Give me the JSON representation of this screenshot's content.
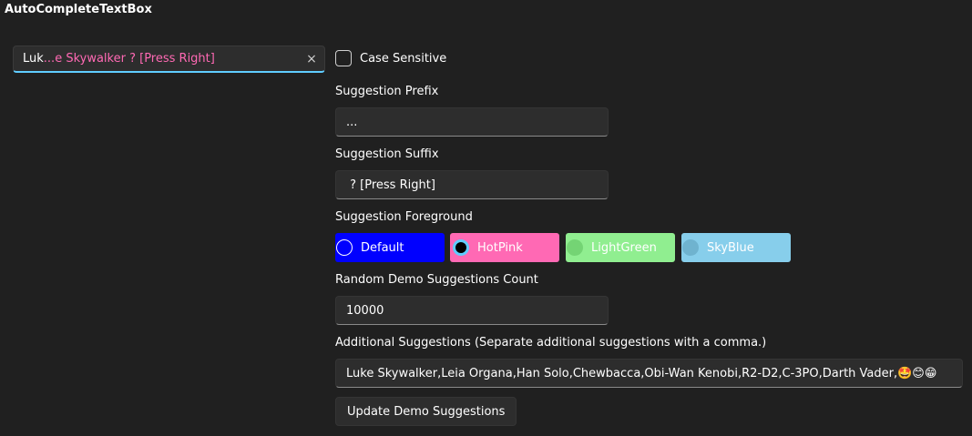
{
  "page": {
    "title": "AutoCompleteTextBox"
  },
  "autocomplete": {
    "typed": "Luk",
    "suggestion": "...e Skywalker ? [Press Right]",
    "clear_icon": "×"
  },
  "options": {
    "case_sensitive_label": "Case Sensitive",
    "suggestion_prefix_label": "Suggestion Prefix",
    "suggestion_prefix_value": "...",
    "suggestion_suffix_label": "Suggestion Suffix",
    "suggestion_suffix_value": " ? [Press Right]",
    "foreground_label": "Suggestion Foreground",
    "foreground_options": [
      {
        "label": "Default",
        "color": "#0000ff",
        "selected": false
      },
      {
        "label": "HotPink",
        "color": "#ff69b4",
        "selected": true
      },
      {
        "label": "LightGreen",
        "color": "#90ee90",
        "selected": false
      },
      {
        "label": "SkyBlue",
        "color": "#87ceeb",
        "selected": false
      }
    ],
    "count_label": "Random Demo Suggestions Count",
    "count_value": "10000",
    "additional_label": "Additional Suggestions (Separate additional suggestions with a comma.)",
    "additional_value": "Luke Skywalker,Leia Organa,Han Solo,Chewbacca,Obi-Wan Kenobi,R2-D2,C-3PO,Darth Vader,🤩😊😁",
    "update_button_label": "Update Demo Suggestions"
  },
  "colors": {
    "accent": "#60cdff",
    "suggestion_text": "#ff69b4"
  }
}
